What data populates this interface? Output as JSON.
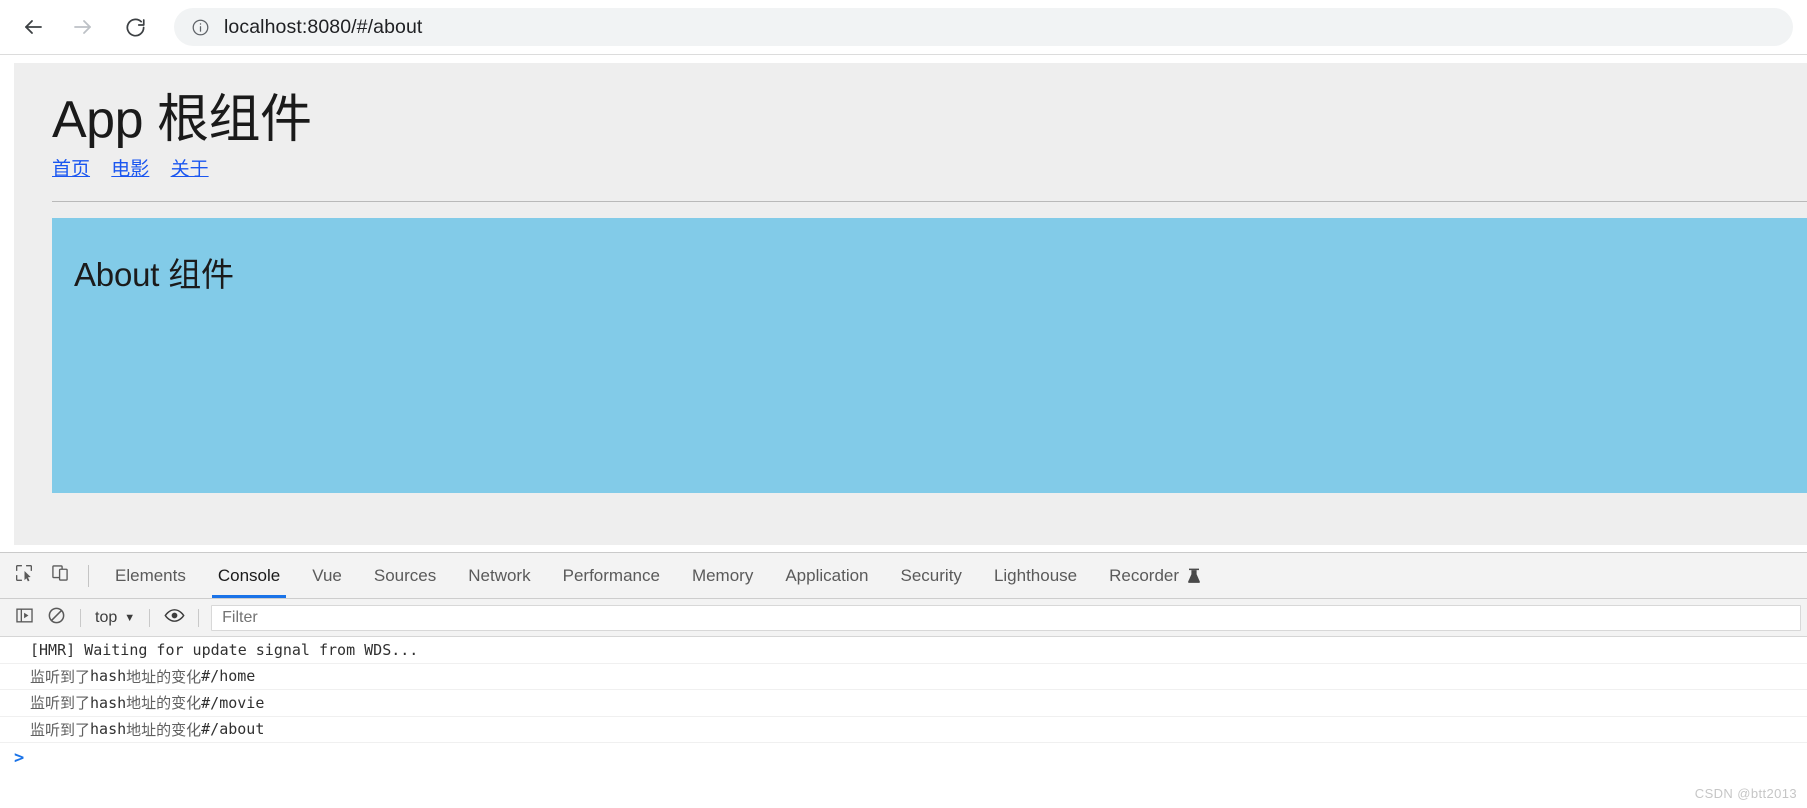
{
  "browser": {
    "back_label": "Back",
    "forward_label": "Forward",
    "reload_label": "Reload",
    "url_scheme_host": "localhost:8080",
    "url_path": "/#/about",
    "url_full": "localhost:8080/#/about",
    "info_icon": "info-circle-icon"
  },
  "page": {
    "title": "App 根组件",
    "nav": [
      {
        "label": "首页",
        "href": "#/home"
      },
      {
        "label": "电影",
        "href": "#/movie"
      },
      {
        "label": "关于",
        "href": "#/about"
      }
    ],
    "about": {
      "heading": "About 组件",
      "bg_color": "#82cbe8"
    },
    "bg_color": "#eeeeee"
  },
  "devtools": {
    "left_icons": [
      {
        "name": "inspect-element-icon",
        "label": "Inspect element"
      },
      {
        "name": "device-toolbar-icon",
        "label": "Toggle device toolbar"
      }
    ],
    "tabs": [
      {
        "label": "Elements",
        "active": false
      },
      {
        "label": "Console",
        "active": true
      },
      {
        "label": "Vue",
        "active": false
      },
      {
        "label": "Sources",
        "active": false
      },
      {
        "label": "Network",
        "active": false
      },
      {
        "label": "Performance",
        "active": false
      },
      {
        "label": "Memory",
        "active": false
      },
      {
        "label": "Application",
        "active": false
      },
      {
        "label": "Security",
        "active": false
      },
      {
        "label": "Lighthouse",
        "active": false
      },
      {
        "label": "Recorder",
        "active": false,
        "icon": "flask-icon"
      }
    ],
    "active_tab": "Console",
    "accent_color": "#1a73e8",
    "filterbar": {
      "sidebar_icon": "console-sidebar-icon",
      "clear_icon": "clear-console-icon",
      "context_label": "top",
      "context_caret": "▼",
      "eye_icon": "live-expression-eye-icon",
      "filter_value": "",
      "filter_placeholder": "Filter"
    },
    "console_messages": [
      {
        "text": "[HMR] Waiting for update signal from WDS...",
        "mono": true
      },
      {
        "cn": "监听到了",
        "mid": " hash ",
        "cn2": "地址的变化",
        "path": " #/home"
      },
      {
        "cn": "监听到了",
        "mid": " hash ",
        "cn2": "地址的变化",
        "path": " #/movie"
      },
      {
        "cn": "监听到了",
        "mid": " hash ",
        "cn2": "地址的变化",
        "path": " #/about"
      }
    ],
    "prompt_symbol": ">"
  },
  "watermark": "CSDN @btt2013"
}
